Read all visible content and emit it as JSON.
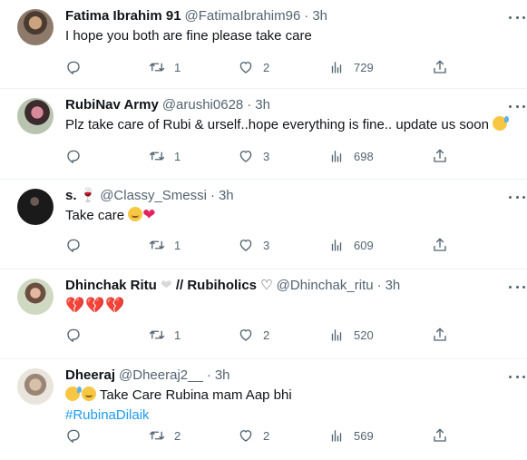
{
  "tweets": [
    {
      "name": "Fatima Ibrahim 91",
      "handle": "@FatimaIbrahim96",
      "time": "3h",
      "text": "I hope you both are fine please take care",
      "counts": {
        "retweets": "1",
        "likes": "2",
        "views": "729"
      }
    },
    {
      "name": "RubiNav Army",
      "handle": "@arushi0628",
      "time": "3h",
      "text": "Plz take care of Rubi & urself..hope everything is fine.. update us soon",
      "counts": {
        "retweets": "1",
        "likes": "3",
        "views": "698"
      }
    },
    {
      "name": "s.",
      "handle": "@Classy_Smessi",
      "time": "3h",
      "text": "Take care",
      "counts": {
        "retweets": "1",
        "likes": "3",
        "views": "609"
      }
    },
    {
      "name": "Dhinchak Ritu",
      "name_suffix": "// Rubiholics ♡",
      "handle": "@Dhinchak_ritu",
      "time": "3h",
      "counts": {
        "retweets": "1",
        "likes": "2",
        "views": "520"
      }
    },
    {
      "name": "Dheeraj",
      "handle": "@Dheeraj2__",
      "time": "3h",
      "text": "Take Care Rubina mam Aap bhi",
      "hashtag": "#RubinaDilaik",
      "counts": {
        "retweets": "2",
        "likes": "2",
        "views": "569"
      }
    }
  ],
  "icons": {
    "reply": "reply-icon",
    "retweet": "retweet-icon",
    "like": "heart-icon",
    "views": "views-chart-icon",
    "share": "share-icon",
    "more": "more-icon"
  },
  "colors": {
    "text": "#0f1419",
    "secondary": "#536471",
    "link": "#1d9bf0",
    "divider": "#eff3f4"
  }
}
